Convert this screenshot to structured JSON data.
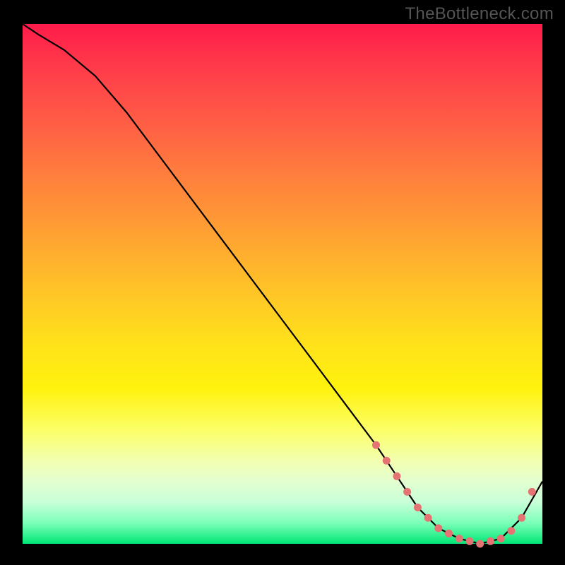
{
  "watermark": "TheBottleneck.com",
  "chart_data": {
    "type": "line",
    "title": "",
    "xlabel": "",
    "ylabel": "",
    "xlim": [
      0,
      100
    ],
    "ylim": [
      0,
      100
    ],
    "grid": false,
    "legend": false,
    "series": [
      {
        "name": "curve",
        "color": "#000000",
        "x": [
          0,
          3,
          8,
          14,
          20,
          26,
          32,
          38,
          44,
          50,
          56,
          62,
          68,
          72,
          76,
          80,
          84,
          88,
          92,
          96,
          100
        ],
        "y": [
          100,
          98,
          95,
          90,
          83,
          75,
          67,
          59,
          51,
          43,
          35,
          27,
          19,
          13,
          7,
          3,
          1,
          0,
          1,
          5,
          12
        ]
      }
    ],
    "markers": {
      "name": "dots",
      "color": "#e57373",
      "x": [
        68,
        70,
        72,
        74,
        76,
        78,
        80,
        82,
        84,
        86,
        88,
        90,
        92,
        94,
        96,
        98
      ],
      "y": [
        19,
        16,
        13,
        10,
        7,
        5,
        3,
        2,
        1,
        0.5,
        0,
        0.5,
        1,
        2.5,
        5,
        10
      ]
    }
  }
}
